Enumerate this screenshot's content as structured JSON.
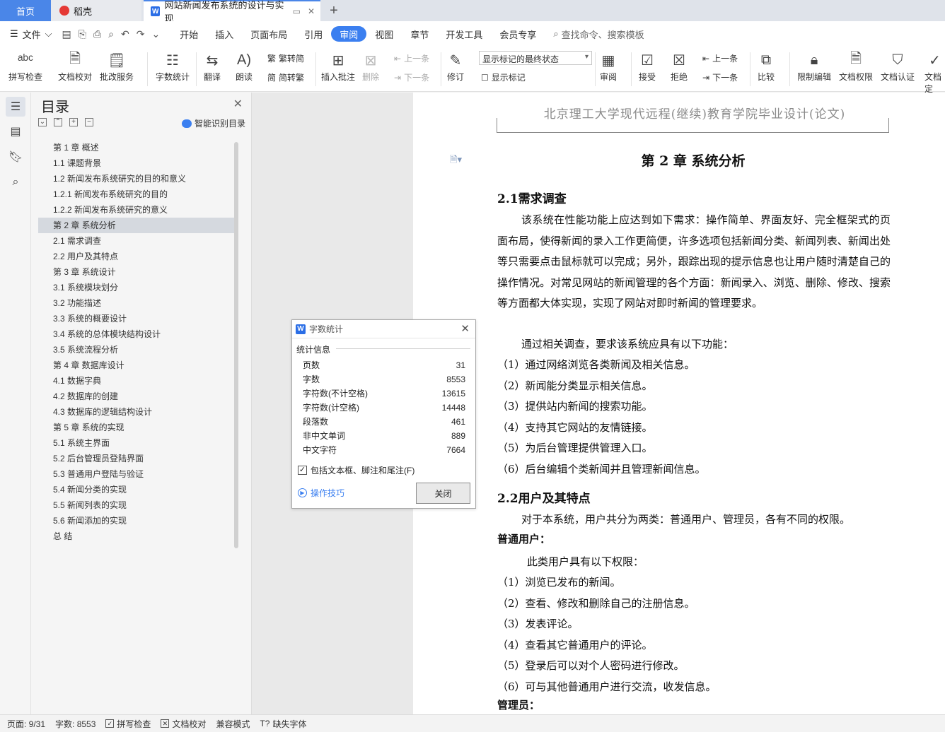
{
  "tabs": {
    "home": "首页",
    "daoke": "稻壳",
    "doc": "网站新闻发布系统的设计与实现",
    "add": "+"
  },
  "menubar": {
    "file": "文件",
    "items": [
      "开始",
      "插入",
      "页面布局",
      "引用",
      "审阅",
      "视图",
      "章节",
      "开发工具",
      "会员专享"
    ],
    "search": "查找命令、搜索模板"
  },
  "ribbon": {
    "spellcheck": "拼写检查",
    "proofread": "文档校对",
    "annotate_service": "批改服务",
    "word_count": "字数统计",
    "translate": "翻译",
    "read_aloud": "朗读",
    "trad_simp": "繁转简",
    "simp_trad": "简转繁",
    "insert_comment": "插入批注",
    "delete": "删除",
    "prev": "上一条",
    "next": "下一条",
    "revise": "修订",
    "markup_mode": "显示标记的最终状态",
    "show_markup": "显示标记",
    "review": "审阅",
    "accept": "接受",
    "reject": "拒绝",
    "prev2": "上一条",
    "next2": "下一条",
    "compare": "比较",
    "restrict_edit": "限制编辑",
    "doc_perm": "文档权限",
    "doc_cert": "文档认证",
    "doc_final": "文档定"
  },
  "toc": {
    "title": "目录",
    "smart": "智能识别目录",
    "items": [
      "第 1 章  概述",
      "1.1  课题背景",
      "1.2 新闻发布系统研究的目的和意义",
      "1.2.1 新闻发布系统研究的目的",
      "1.2.2 新闻发布系统研究的意义",
      "第 2 章  系统分析",
      "2.1 需求调查",
      "2.2 用户及其特点",
      "第 3 章  系统设计",
      "3.1 系统模块划分",
      "3.2  功能描述",
      "3.3 系统的概要设计",
      "3.4  系统的总体模块结构设计",
      "3.5 系统流程分析",
      "第 4 章  数据库设计",
      "4.1 数据字典",
      "4.2 数据库的创建",
      "4.3 数据库的逻辑结构设计",
      "第 5 章  系统的实现",
      "5.1  系统主界面",
      "5.2  后台管理员登陆界面",
      "5.3  普通用户登陆与验证",
      "5.4 新闻分类的实现",
      "5.5  新闻列表的实现",
      "5.6  新闻添加的实现",
      "总    结"
    ]
  },
  "page": {
    "header": "北京理工大学现代远程(继续)教育学院毕业设计(论文)",
    "chapter": "第 2 章  系统分析",
    "h21": "2.1需求调查",
    "p1": "该系统在性能功能上应达到如下需求：操作简单、界面友好、完全框架式的页面布局，使得新闻的录入工作更简便，许多选项包括新闻分类、新闻列表、新闻出处等只需要点击鼠标就可以完成；另外，跟踪出现的提示信息也让用户随时清楚自己的操作情况。对常见网站的新闻管理的各个方面：新闻录入、浏览、删除、修改、搜索等方面都大体实现，实现了网站对即时新闻的管理要求。",
    "p2": "通过相关调查，要求该系统应具有以下功能：",
    "list1": [
      "（1）通过网络浏览各类新闻及相关信息。",
      "（2）新闻能分类显示相关信息。",
      "（3）提供站内新闻的搜索功能。",
      "（4）支持其它网站的友情链接。",
      "（5）为后台管理提供管理入口。",
      "（6）后台编辑个类新闻并且管理新闻信息。"
    ],
    "h22": "2.2用户及其特点",
    "p3": "对于本系统，用户共分为两类：普通用户、管理员，各有不同的权限。",
    "normal_user": "普通用户：",
    "p4": "此类用户具有以下权限：",
    "list2": [
      "（1）浏览已发布的新闻。",
      "（2）查看、修改和删除自己的注册信息。",
      "（3）发表评论。",
      "（4）查看其它普通用户的评论。",
      "（5）登录后可以对个人密码进行修改。",
      "（6）可与其他普通用户进行交流，收发信息。"
    ],
    "admin": "管理员："
  },
  "dialog": {
    "title": "字数统计",
    "group": "统计信息",
    "stats": [
      {
        "label": "页数",
        "value": "31"
      },
      {
        "label": "字数",
        "value": "8553"
      },
      {
        "label": "字符数(不计空格)",
        "value": "13615"
      },
      {
        "label": "字符数(计空格)",
        "value": "14448"
      },
      {
        "label": "段落数",
        "value": "461"
      },
      {
        "label": "非中文单词",
        "value": "889"
      },
      {
        "label": "中文字符",
        "value": "7664"
      }
    ],
    "include": "包括文本框、脚注和尾注(F)",
    "tips": "操作技巧",
    "close": "关闭"
  },
  "status": {
    "page": "页面: 9/31",
    "words": "字数: 8553",
    "spell": "拼写检查",
    "proof": "文档校对",
    "compat": "兼容模式",
    "missing_font": "缺失字体"
  },
  "colors": {
    "accent": "#3b7ff0",
    "home_tab": "#4a86e8"
  }
}
